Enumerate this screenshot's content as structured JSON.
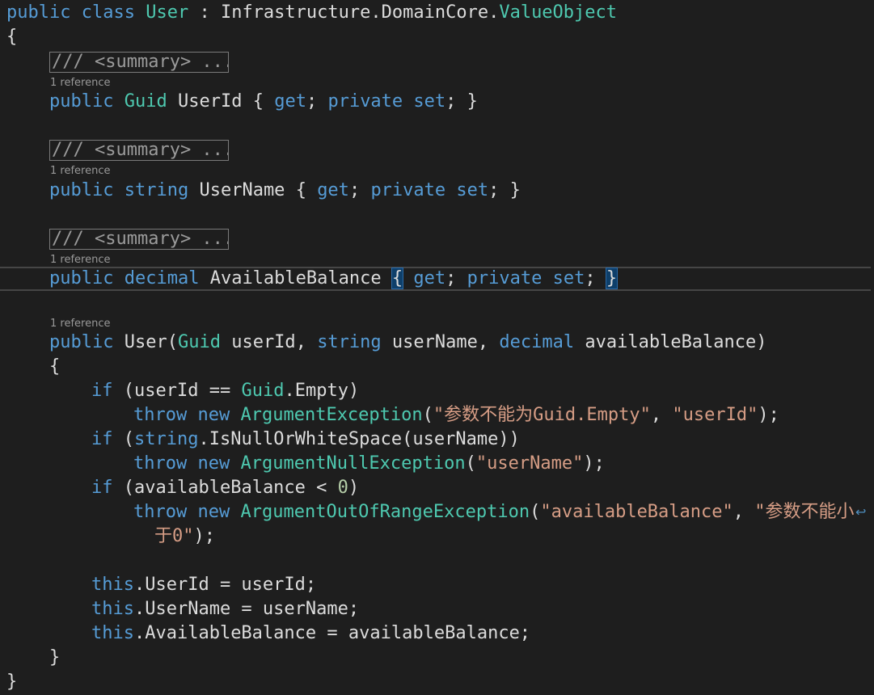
{
  "code": {
    "class_decl": {
      "public_kw": "public",
      "class_kw": "class",
      "class_name": "User",
      "colon": " : ",
      "base_namespace": "Infrastructure.DomainCore.",
      "base_type": "ValueObject"
    },
    "open_brace": "{",
    "close_brace": "}",
    "collapsed_summary": "/// <summary> ...",
    "reference_lens": "1 reference",
    "prop_userid": {
      "public_kw": "public",
      "type": "Guid",
      "name": "UserId",
      "open": "{",
      "get_kw": "get",
      "semi1": ";",
      "private_kw": "private",
      "set_kw": "set",
      "semi2": ";",
      "close": "}"
    },
    "prop_username": {
      "public_kw": "public",
      "type": "string",
      "name": "UserName",
      "open": "{",
      "get_kw": "get",
      "semi1": ";",
      "private_kw": "private",
      "set_kw": "set",
      "semi2": ";",
      "close": "}"
    },
    "prop_balance": {
      "public_kw": "public",
      "type": "decimal",
      "name": "AvailableBalance",
      "open": "{",
      "get_kw": "get",
      "semi1": ";",
      "private_kw": "private",
      "set_kw": "set",
      "semi2": ";",
      "close": "}"
    },
    "ctor": {
      "public_kw": "public",
      "name": "User",
      "paren_open": "(",
      "p1_type": "Guid",
      "p1_name": "userId",
      "comma": ",",
      "p2_type": "string",
      "p2_name": "userName",
      "p3_type": "decimal",
      "p3_name": "availableBalance",
      "paren_close": ")",
      "open": "{",
      "close": "}"
    },
    "if1": {
      "if_kw": "if",
      "open": "(",
      "var": "userId",
      "op": "==",
      "type": "Guid",
      "member": ".Empty",
      "close": ")"
    },
    "throw1": {
      "throw_kw": "throw",
      "new_kw": "new",
      "type": "ArgumentException",
      "open": "(",
      "msg": "\"参数不能为Guid.Empty\"",
      "comma": ",",
      "param": "\"userId\"",
      "close": ");"
    },
    "if2": {
      "if_kw": "if",
      "open": "(",
      "type": "string",
      "call": ".IsNullOrWhiteSpace(userName))"
    },
    "throw2": {
      "throw_kw": "throw",
      "new_kw": "new",
      "type": "ArgumentNullException",
      "open": "(",
      "param": "\"userName\"",
      "close": ");"
    },
    "if3": {
      "if_kw": "if",
      "open": "(",
      "var": "availableBalance",
      "op": "<",
      "num": "0",
      "close": ")"
    },
    "throw3": {
      "throw_kw": "throw",
      "new_kw": "new",
      "type": "ArgumentOutOfRangeException",
      "open": "(",
      "param": "\"availableBalance\"",
      "comma": ",",
      "msg_part1": "\"参数不能小",
      "msg_part2": "于0\"",
      "close": ");"
    },
    "assign1": {
      "this_kw": "this",
      "rest": ".UserId = userId;"
    },
    "assign2": {
      "this_kw": "this",
      "rest": ".UserName = userName;"
    },
    "assign3": {
      "this_kw": "this",
      "rest": ".AvailableBalance = availableBalance;"
    },
    "wrap_glyph": "↩"
  },
  "colors": {
    "background": "#1e1e1e",
    "keyword": "#569cd6",
    "type": "#4ec9b0",
    "string": "#d69d85",
    "number": "#b5cea8",
    "text": "#dcdcdc",
    "lens": "#999999"
  }
}
